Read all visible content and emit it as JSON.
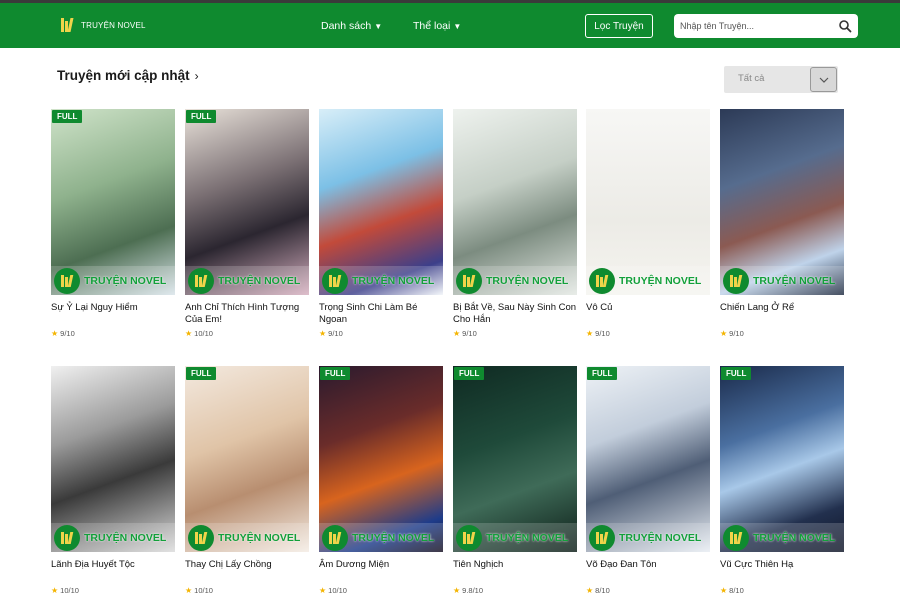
{
  "header": {
    "logo_text": "TRUYỆN NOVEL",
    "nav": [
      {
        "label": "Danh sách",
        "caret": "▼"
      },
      {
        "label": "Thể loại",
        "caret": "▼"
      }
    ],
    "filter_button": "Lọc Truyện",
    "search_placeholder": "Nhập tên Truyện..."
  },
  "section": {
    "title": "Truyện mới cập nhật",
    "chevron": "›",
    "select_value": "Tất cả"
  },
  "watermark": "TRUYỆN NOVEL",
  "colors": {
    "brand": "#0f8a2f",
    "accent": "#f0d44a",
    "star": "#f4b400"
  },
  "books": [
    {
      "title": "Sự Ỷ Lại Nguy Hiểm",
      "rating": "9/10",
      "badge": "FULL"
    },
    {
      "title": "Anh Chỉ Thích Hình Tượng Của Em!",
      "rating": "10/10",
      "badge": "FULL"
    },
    {
      "title": "Trọng Sinh Chi Làm Bé Ngoan",
      "rating": "9/10",
      "badge": ""
    },
    {
      "title": "Bị Bắt Về, Sau Này Sinh Con Cho Hắn",
      "rating": "9/10",
      "badge": ""
    },
    {
      "title": "Vô Củ",
      "rating": "9/10",
      "badge": ""
    },
    {
      "title": "Chiến Lang Ở Rể",
      "rating": "9/10",
      "badge": ""
    },
    {
      "title": "Lãnh Địa Huyết Tộc",
      "rating": "10/10",
      "badge": ""
    },
    {
      "title": "Thay Chị Lấy Chồng",
      "rating": "10/10",
      "badge": "FULL"
    },
    {
      "title": "Âm Dương Miện",
      "rating": "10/10",
      "badge": "FULL"
    },
    {
      "title": "Tiên Nghịch",
      "rating": "9.8/10",
      "badge": "FULL"
    },
    {
      "title": "Võ Đạo Đan Tôn",
      "rating": "8/10",
      "badge": "FULL"
    },
    {
      "title": "Vũ Cực Thiên Hạ",
      "rating": "8/10",
      "badge": "FULL"
    }
  ]
}
